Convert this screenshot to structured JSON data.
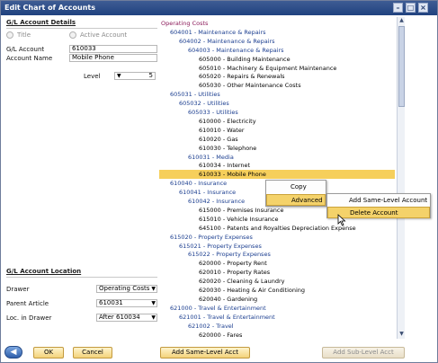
{
  "window": {
    "title": "Edit Chart of Accounts"
  },
  "details": {
    "section_title": "G/L Account Details",
    "radio_title_label": "Title",
    "radio_active_label": "Active Account",
    "gl_account_label": "G/L Account",
    "gl_account_value": "610033",
    "account_name_label": "Account Name",
    "account_name_value": "Mobile Phone",
    "level_label": "Level",
    "level_value": "5"
  },
  "location": {
    "section_title": "G/L Account Location",
    "drawer_label": "Drawer",
    "drawer_value": "Operating Costs",
    "parent_article_label": "Parent Article",
    "parent_article_value": "610031",
    "loc_in_drawer_label": "Loc. in Drawer",
    "loc_in_drawer_value": "After 610034"
  },
  "tree": {
    "rows": [
      {
        "text": "Operating Costs",
        "kind": "root",
        "indent": 0
      },
      {
        "text": "604001 - Maintenance & Repairs",
        "kind": "group",
        "indent": 1
      },
      {
        "text": "604002 - Maintenance & Repairs",
        "kind": "group",
        "indent": 2
      },
      {
        "text": "604003 - Maintenance & Repairs",
        "kind": "group",
        "indent": 3
      },
      {
        "text": "605000 - Building Maintenance",
        "kind": "leaf",
        "indent": 4
      },
      {
        "text": "605010 - Machinery & Equipment Maintenance",
        "kind": "leaf",
        "indent": 4
      },
      {
        "text": "605020 - Repairs & Renewals",
        "kind": "leaf",
        "indent": 4
      },
      {
        "text": "605030 - Other Maintenance Costs",
        "kind": "leaf",
        "indent": 4
      },
      {
        "text": "605031 - Utilities",
        "kind": "group",
        "indent": 1
      },
      {
        "text": "605032 - Utilities",
        "kind": "group",
        "indent": 2
      },
      {
        "text": "605033 - Utilities",
        "kind": "group",
        "indent": 3
      },
      {
        "text": "610000 - Electricity",
        "kind": "leaf",
        "indent": 4
      },
      {
        "text": "610010 - Water",
        "kind": "leaf",
        "indent": 4
      },
      {
        "text": "610020 - Gas",
        "kind": "leaf",
        "indent": 4
      },
      {
        "text": "610030 - Telephone",
        "kind": "leaf",
        "indent": 4
      },
      {
        "text": "610031 - Media",
        "kind": "group",
        "indent": 3
      },
      {
        "text": "610034 - Internet",
        "kind": "leaf",
        "indent": 4
      },
      {
        "text": "610033 - Mobile Phone",
        "kind": "leaf-sel",
        "indent": 4
      },
      {
        "text": "610040 - Insurance",
        "kind": "group",
        "indent": 1
      },
      {
        "text": "610041 - Insurance",
        "kind": "group",
        "indent": 2
      },
      {
        "text": "610042 - Insurance",
        "kind": "group",
        "indent": 3
      },
      {
        "text": "615000 - Premises Insurance",
        "kind": "leaf",
        "indent": 4
      },
      {
        "text": "615010 - Vehicle Insurance",
        "kind": "leaf",
        "indent": 4
      },
      {
        "text": "645100 - Patents and Royalties Depreciation Expense",
        "kind": "leaf",
        "indent": 4
      },
      {
        "text": "615020 - Property Expenses",
        "kind": "group",
        "indent": 1
      },
      {
        "text": "615021 - Property Expenses",
        "kind": "group",
        "indent": 2
      },
      {
        "text": "615022 - Property Expenses",
        "kind": "group",
        "indent": 3
      },
      {
        "text": "620000 - Property Rent",
        "kind": "leaf",
        "indent": 4
      },
      {
        "text": "620010 - Property Rates",
        "kind": "leaf",
        "indent": 4
      },
      {
        "text": "620020 - Cleaning & Laundry",
        "kind": "leaf",
        "indent": 4
      },
      {
        "text": "620030 - Heating & Air Conditioning",
        "kind": "leaf",
        "indent": 4
      },
      {
        "text": "620040 - Gardening",
        "kind": "leaf",
        "indent": 4
      },
      {
        "text": "621000 - Travel & Entertainment",
        "kind": "group",
        "indent": 1
      },
      {
        "text": "621001 - Travel & Entertainment",
        "kind": "group",
        "indent": 2
      },
      {
        "text": "621002 - Travel",
        "kind": "group",
        "indent": 3
      },
      {
        "text": "620000 - Fares",
        "kind": "leaf",
        "indent": 4
      }
    ]
  },
  "context_menu": {
    "copy": "Copy",
    "advanced": "Advanced",
    "add_same_level": "Add Same-Level Account",
    "delete_account": "Delete Account"
  },
  "footer": {
    "ok": "OK",
    "cancel": "Cancel",
    "add_same_level_acct": "Add Same-Level Acct",
    "add_sub_level_acct": "Add Sub-Level Acct"
  },
  "colors": {
    "title_bar": "#20427f",
    "highlight": "#f6cf5b",
    "group_text": "#1a3d8f",
    "root_text": "#8b1a5a"
  }
}
